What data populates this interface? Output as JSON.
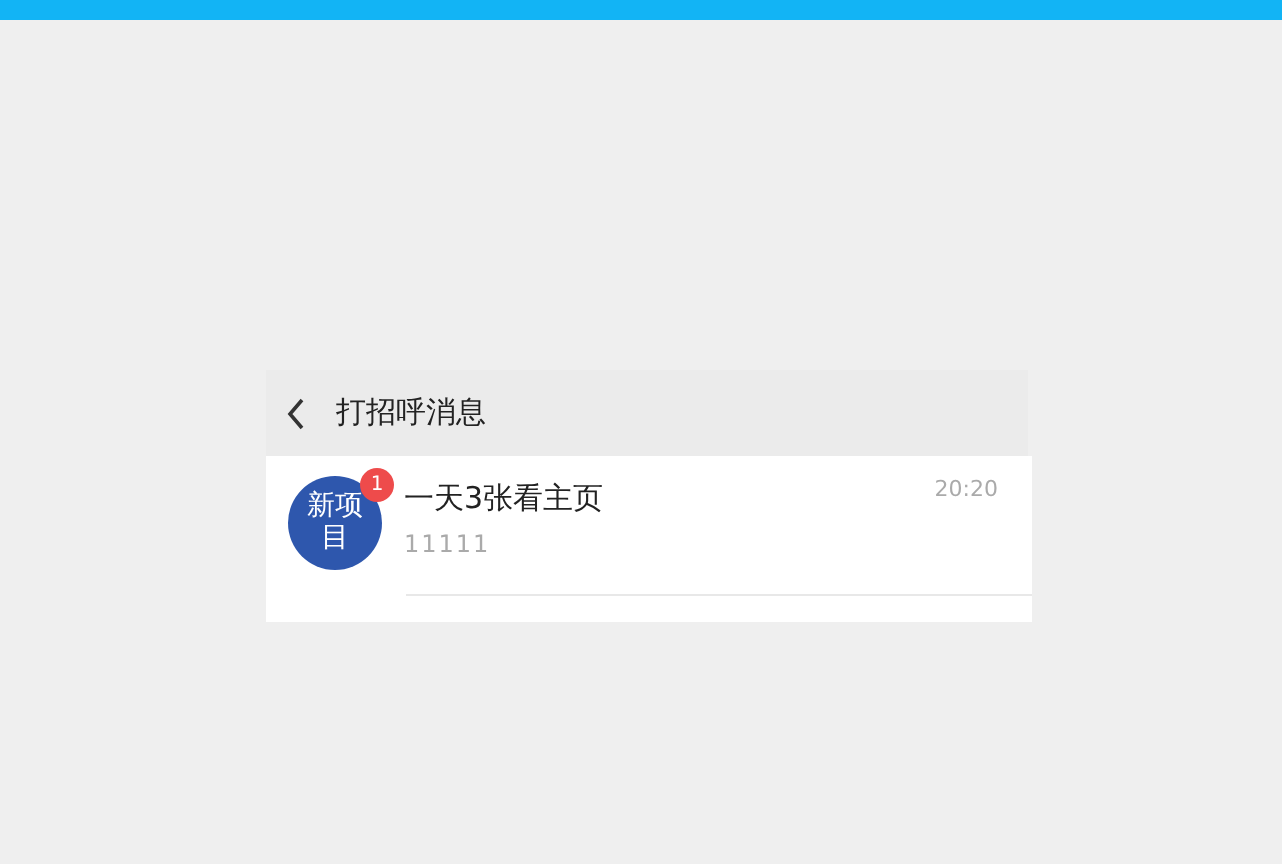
{
  "header": {
    "title": "打招呼消息"
  },
  "messages": [
    {
      "avatar_text": "新项目",
      "badge": "1",
      "title": "一天3张看主页",
      "preview": "11111",
      "time": "20:20"
    }
  ]
}
